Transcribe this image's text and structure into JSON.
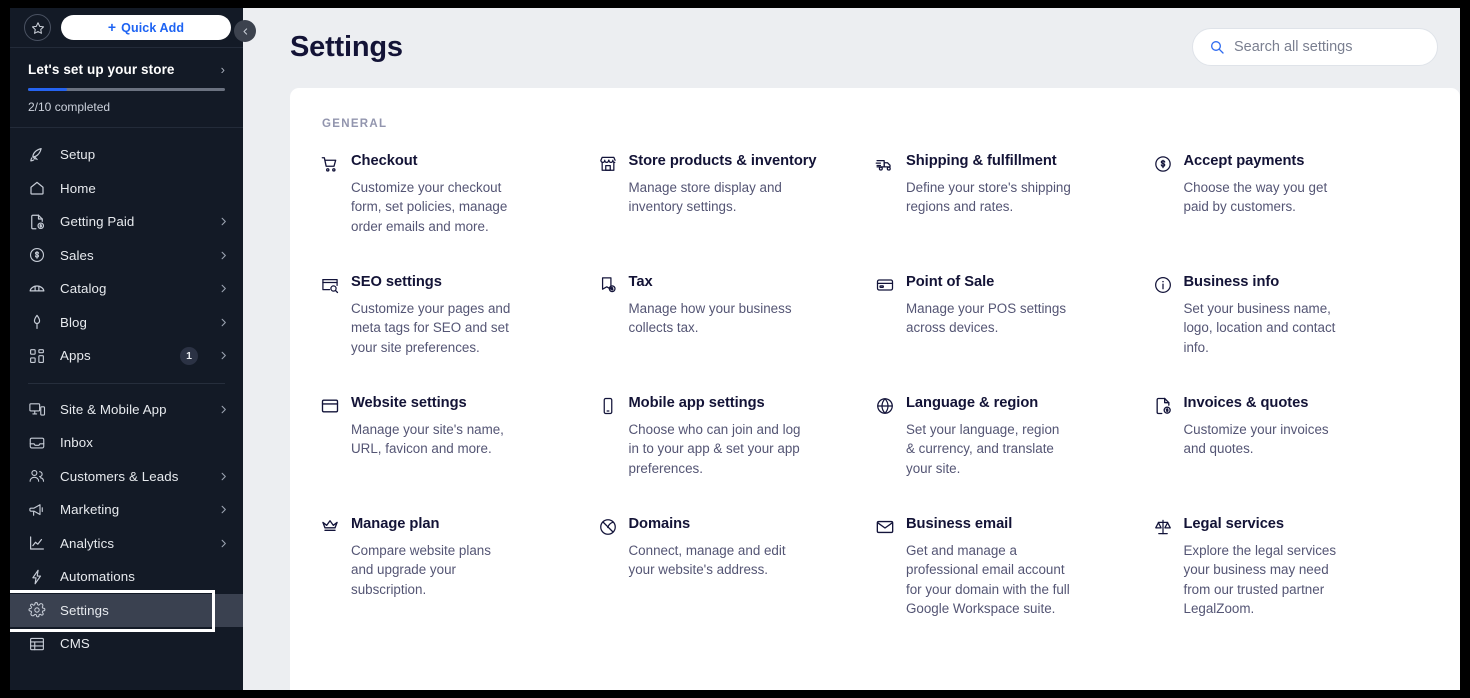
{
  "sidebar": {
    "star_icon": "star-icon",
    "quick_add_label": "Quick Add",
    "quick_add_plus": "+",
    "setup": {
      "title": "Let's set up your store",
      "chevron": "›",
      "progress_percent": 20,
      "count_label": "2/10 completed"
    },
    "groups": [
      {
        "items": [
          {
            "label": "Setup",
            "icon": "rocket-icon",
            "chevron": false,
            "badge": null
          },
          {
            "label": "Home",
            "icon": "home-icon",
            "chevron": false,
            "badge": null
          },
          {
            "label": "Getting Paid",
            "icon": "invoice-dollar-icon",
            "chevron": true,
            "badge": null
          },
          {
            "label": "Sales",
            "icon": "dollar-circle-icon",
            "chevron": true,
            "badge": null
          },
          {
            "label": "Catalog",
            "icon": "catalog-icon",
            "chevron": true,
            "badge": null
          },
          {
            "label": "Blog",
            "icon": "pen-nib-icon",
            "chevron": true,
            "badge": null
          },
          {
            "label": "Apps",
            "icon": "apps-grid-icon",
            "chevron": true,
            "badge": "1"
          }
        ]
      },
      {
        "items": [
          {
            "label": "Site & Mobile App",
            "icon": "monitor-mobile-icon",
            "chevron": true,
            "badge": null
          },
          {
            "label": "Inbox",
            "icon": "inbox-icon",
            "chevron": false,
            "badge": null
          },
          {
            "label": "Customers & Leads",
            "icon": "people-icon",
            "chevron": true,
            "badge": null
          },
          {
            "label": "Marketing",
            "icon": "megaphone-icon",
            "chevron": true,
            "badge": null
          },
          {
            "label": "Analytics",
            "icon": "chart-line-icon",
            "chevron": true,
            "badge": null
          },
          {
            "label": "Automations",
            "icon": "bolt-icon",
            "chevron": false,
            "badge": null
          },
          {
            "label": "Settings",
            "icon": "gear-icon",
            "chevron": false,
            "badge": null,
            "selected": true
          },
          {
            "label": "CMS",
            "icon": "table-grid-icon",
            "chevron": false,
            "badge": null
          }
        ]
      }
    ],
    "collapse_icon": "chevron-left-icon"
  },
  "header": {
    "title": "Settings",
    "search": {
      "icon": "search-icon",
      "placeholder": "Search all settings",
      "value": ""
    }
  },
  "main": {
    "section_label": "GENERAL",
    "cards": [
      {
        "title": "Checkout",
        "desc": "Customize your checkout form, set policies, manage order emails and more.",
        "icon": "shopping-cart-icon"
      },
      {
        "title": "Store products & inventory",
        "desc": "Manage store display and inventory settings.",
        "icon": "storefront-icon"
      },
      {
        "title": "Shipping & fulfillment",
        "desc": "Define your store's shipping regions and rates.",
        "icon": "delivery-truck-icon"
      },
      {
        "title": "Accept payments",
        "desc": "Choose the way you get paid by customers.",
        "icon": "dollar-circle-icon"
      },
      {
        "title": "SEO settings",
        "desc": "Customize your pages and meta tags for SEO and set your site preferences.",
        "icon": "seo-search-icon"
      },
      {
        "title": "Tax",
        "desc": "Manage how your business collects tax.",
        "icon": "tax-dollar-icon"
      },
      {
        "title": "Point of Sale",
        "desc": "Manage your POS settings across devices.",
        "icon": "card-terminal-icon"
      },
      {
        "title": "Business info",
        "desc": "Set your business name, logo, location and contact info.",
        "icon": "info-circle-icon"
      },
      {
        "title": "Website settings",
        "desc": "Manage your site's name, URL, favicon and more.",
        "icon": "browser-window-icon"
      },
      {
        "title": "Mobile app settings",
        "desc": "Choose who can join and log in to your app & set your app preferences.",
        "icon": "mobile-phone-icon"
      },
      {
        "title": "Language & region",
        "desc": "Set your language, region & currency, and translate your site.",
        "icon": "globe-icon"
      },
      {
        "title": "Invoices & quotes",
        "desc": "Customize your invoices and quotes.",
        "icon": "invoice-dollar-icon"
      },
      {
        "title": "Manage plan",
        "desc": "Compare website plans and upgrade your subscription.",
        "icon": "crown-icon"
      },
      {
        "title": "Domains",
        "desc": "Connect, manage and edit your website's address.",
        "icon": "domain-globe-icon"
      },
      {
        "title": "Business email",
        "desc": "Get and manage a professional email account for your domain with the full Google Workspace suite.",
        "icon": "envelope-icon"
      },
      {
        "title": "Legal services",
        "desc": "Explore the legal services your business may need from our trusted partner LegalZoom.",
        "icon": "scales-justice-icon"
      }
    ]
  },
  "colors": {
    "sidebar_bg": "#131a26",
    "page_bg": "#eceef1",
    "card_bg": "#ffffff",
    "accent_blue": "#1d63f3",
    "progress_blue": "#2563f0",
    "title_ink": "#131336",
    "body_ink": "#545574",
    "section_label": "#9295ae",
    "selection_ring": "#ffffff"
  }
}
